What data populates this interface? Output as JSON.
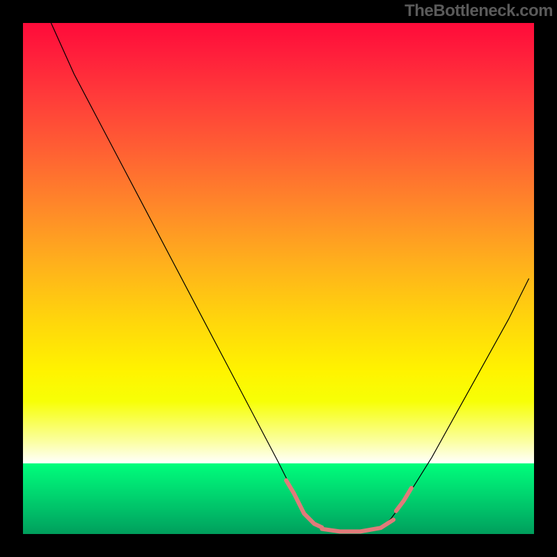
{
  "watermark": "TheBottleneck.com",
  "chart_data": {
    "type": "line",
    "title": "",
    "xlabel": "",
    "ylabel": "",
    "xlim": [
      0,
      100
    ],
    "ylim": [
      0,
      100
    ],
    "grid": false,
    "series": [
      {
        "name": "curve",
        "x": [
          5.5,
          10,
          15,
          20,
          25,
          30,
          35,
          40,
          45,
          50,
          53,
          55,
          58,
          60,
          62,
          65,
          68,
          70,
          72,
          75,
          80,
          85,
          90,
          95,
          99
        ],
        "y": [
          100,
          90,
          80.5,
          71,
          61.5,
          52,
          42.5,
          33,
          23.5,
          14,
          8,
          4,
          1.2,
          0.6,
          0.5,
          0.5,
          0.6,
          1.2,
          3,
          7,
          15,
          24,
          33,
          42,
          50
        ]
      }
    ],
    "accent_segments": [
      {
        "x": [
          51.5,
          53,
          55,
          57,
          58.5
        ],
        "y": [
          10.5,
          8,
          4,
          2,
          1.3
        ]
      },
      {
        "x": [
          58.5,
          62,
          66,
          70,
          72.5
        ],
        "y": [
          1.0,
          0.5,
          0.5,
          1.2,
          2.8
        ]
      },
      {
        "x": [
          73,
          74.5,
          76
        ],
        "y": [
          4.5,
          6.5,
          9
        ]
      }
    ],
    "background_gradient": {
      "stops": [
        {
          "pos": 0,
          "color": "#ff0b3a"
        },
        {
          "pos": 25,
          "color": "#ff6033"
        },
        {
          "pos": 58,
          "color": "#ffd50c"
        },
        {
          "pos": 82,
          "color": "#fbffa3"
        },
        {
          "pos": 86.2,
          "color_above": "#ffffff",
          "color_below": "#00ff7b"
        },
        {
          "pos": 100,
          "color": "#009e5c"
        }
      ]
    }
  }
}
